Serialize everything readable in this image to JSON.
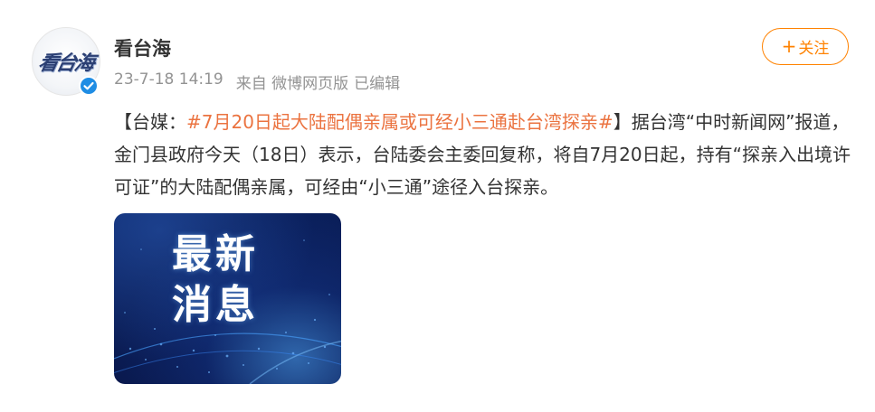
{
  "post": {
    "author": {
      "name": "看台海",
      "avatar_logo": "看台海",
      "verified_icon": "verified-badge-icon"
    },
    "meta": {
      "time": "23-7-18 14:19",
      "source": "来自 微博网页版",
      "edited": "已编辑"
    },
    "follow_button": {
      "icon": "+",
      "label": "关注"
    },
    "content": {
      "prefix": "【台媒：",
      "topic": "#7月20日起大陆配偶亲属或可经小三通赴台湾探亲#",
      "body": "】据台湾“中时新闻网”报道，金门县政府今天（18日）表示，台陆委会主委回复称，将自7月20日起，持有“探亲入出境许可证”的大陆配偶亲属，可经由“小三通”途径入台探亲。"
    },
    "image": {
      "line1": "最新",
      "line2": "消息"
    }
  },
  "colors": {
    "accent": "#ff8200",
    "topic": "#eb7340",
    "verified": "#1f8de4",
    "meta_text": "#939393"
  }
}
